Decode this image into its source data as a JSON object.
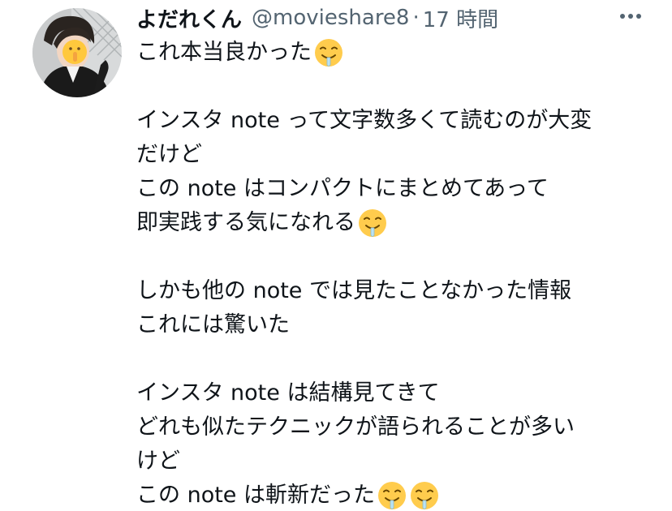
{
  "tweet": {
    "display_name": "よだれくん",
    "handle": "@movieshare8",
    "separator": "·",
    "time": "17 時間",
    "more_icon": "more-horizontal-icon",
    "avatar_icon": "profile-photo",
    "lines": [
      "これ本当良かった",
      "インスタ note って文字数多くて読むのが大変",
      "だけど",
      "この note はコンパクトにまとめてあって",
      "即実践する気になれる",
      "しかも他の note では見たことなかった情報",
      "これには驚いた",
      "インスタ note は結構見てきて",
      "どれも似たテクニックが語られることが多い",
      "けど",
      "この note は斬新だった"
    ],
    "emoji_name": "drooling-face-emoji"
  }
}
